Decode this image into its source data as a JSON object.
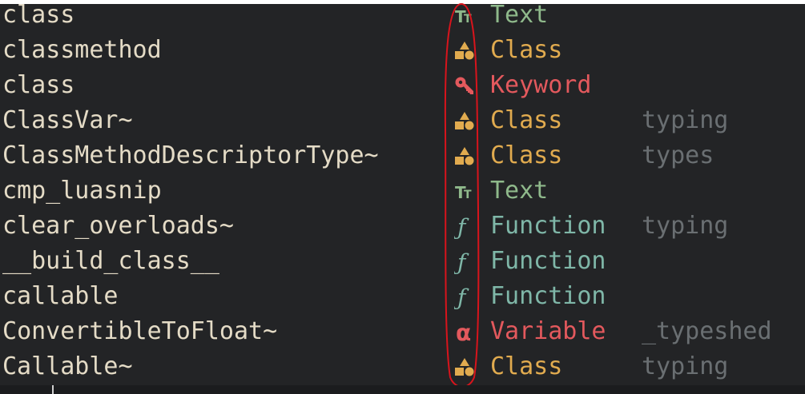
{
  "completion_menu": {
    "items": [
      {
        "word_head": "cla",
        "word_tail": "ss",
        "kind_label": "Text",
        "menu": "",
        "icon": "text-icon",
        "kind_color": "#8fb98b"
      },
      {
        "word_head": "cla",
        "word_tail": "ssmethod",
        "kind_label": "Class",
        "menu": "",
        "icon": "class-icon",
        "kind_color": "#e1ab4f"
      },
      {
        "word_head": "cla",
        "word_tail": "ss",
        "kind_label": "Keyword",
        "menu": "",
        "icon": "keyword-icon",
        "kind_color": "#e3595d"
      },
      {
        "word_head": "Cla",
        "word_tail": "ssVar~",
        "kind_label": "Class",
        "menu": "typing",
        "icon": "class-icon",
        "kind_color": "#e1ab4f"
      },
      {
        "word_head": "Cla",
        "word_tail": "ssMethodDescriptorType~",
        "kind_label": "Class",
        "menu": "types",
        "icon": "class-icon",
        "kind_color": "#e1ab4f"
      },
      {
        "word_head": "c",
        "word_tail": "mp_luasnip",
        "kind_label": "Text",
        "menu": "",
        "icon": "text-icon",
        "kind_color": "#8fb98b"
      },
      {
        "word_head": "cl",
        "word_tail": "ear_overloads~",
        "kind_label": "Function",
        "menu": "typing",
        "icon": "function-icon",
        "kind_color": "#7fb7a8"
      },
      {
        "word_head": "__build_class__",
        "word_tail": "",
        "kind_label": "Function",
        "menu": "",
        "icon": "function-icon",
        "kind_color": "#7fb7a8"
      },
      {
        "word_head": "ca",
        "word_tail": "llable",
        "kind_label": "Function",
        "menu": "",
        "icon": "function-icon",
        "kind_color": "#7fb7a8"
      },
      {
        "word_head": "C",
        "word_tail": "onvertibleToFloat~",
        "kind_label": "Variable",
        "menu": "_typeshed",
        "icon": "variable-icon",
        "kind_color": "#e3595d"
      },
      {
        "word_head": "Ca",
        "word_tail": "llable~",
        "kind_label": "Class",
        "menu": "typing",
        "icon": "class-icon",
        "kind_color": "#e1ab4f"
      }
    ]
  },
  "colors": {
    "background": "#232426",
    "word": "#e4dbc6",
    "menu": "#6a6f72",
    "text_kind": "#8fb98b",
    "class_kind": "#e1ab4f",
    "keyword_kind": "#e3595d",
    "function_kind": "#7fb7a8",
    "variable_kind": "#e3595d",
    "annotation": "#d8141c"
  }
}
